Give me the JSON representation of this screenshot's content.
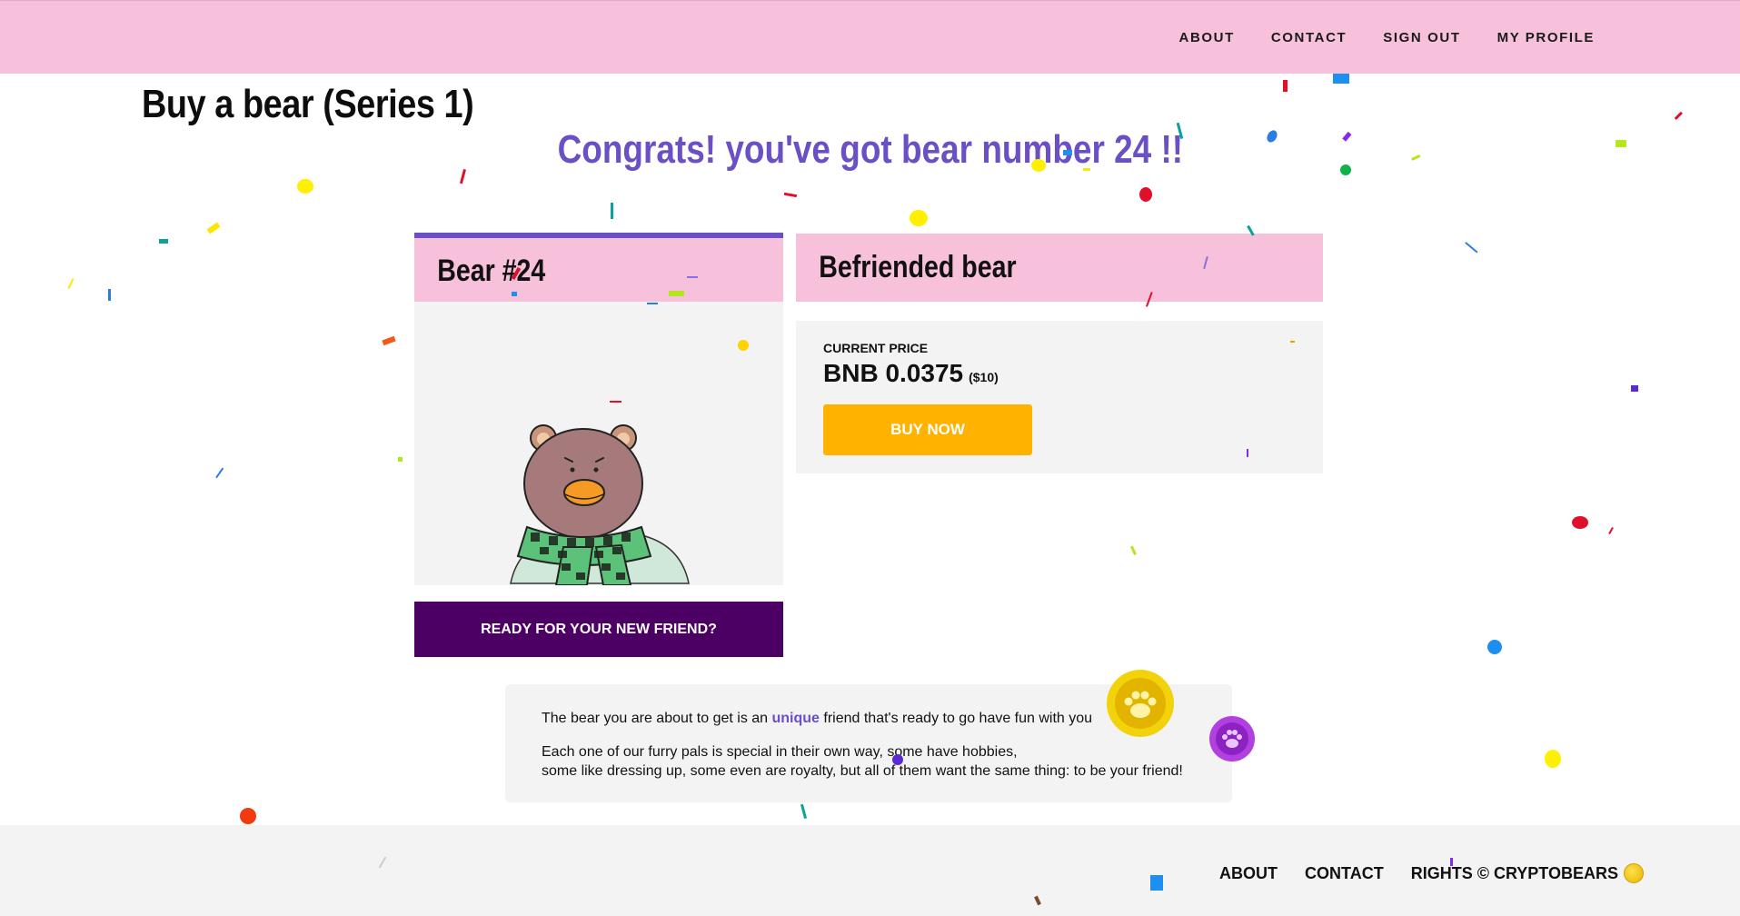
{
  "nav": {
    "items": [
      {
        "label": "ABOUT"
      },
      {
        "label": "CONTACT"
      },
      {
        "label": "SIGN OUT"
      },
      {
        "label": "MY PROFILE"
      }
    ]
  },
  "page": {
    "title": "Buy a bear (Series 1)",
    "congrats": "Congrats! you've got bear number 24 !!"
  },
  "bear_card": {
    "title": "Bear #24",
    "image_icon": "bear-with-green-plaid-scarf",
    "cta_label": "READY FOR YOUR NEW FRIEND?"
  },
  "price_panel": {
    "title": "Befriended bear",
    "price_label": "CURRENT PRICE",
    "price_value": "BNB 0.0375",
    "price_usd": "($10)",
    "buy_label": "BUY NOW"
  },
  "info": {
    "line1_prefix": "The bear you are about to get is an ",
    "line1_highlight": "unique",
    "line1_suffix": " friend that's ready to go have fun with you",
    "line2": "Each one of our furry pals is special in their own way, some have hobbies,",
    "line3": "some like dressing up, some even are royalty, but all of them want the same thing: to be your friend!"
  },
  "footer": {
    "about": "ABOUT",
    "contact": "CONTACT",
    "rights": "RIGHTS © CRYPTOBEARS"
  },
  "colors": {
    "nav_pink": "#f7c1dc",
    "accent_purple": "#6b4fc4",
    "cta_dark_purple": "#4d0064",
    "buy_orange": "#ffb300",
    "panel_grey": "#f3f3f3"
  }
}
